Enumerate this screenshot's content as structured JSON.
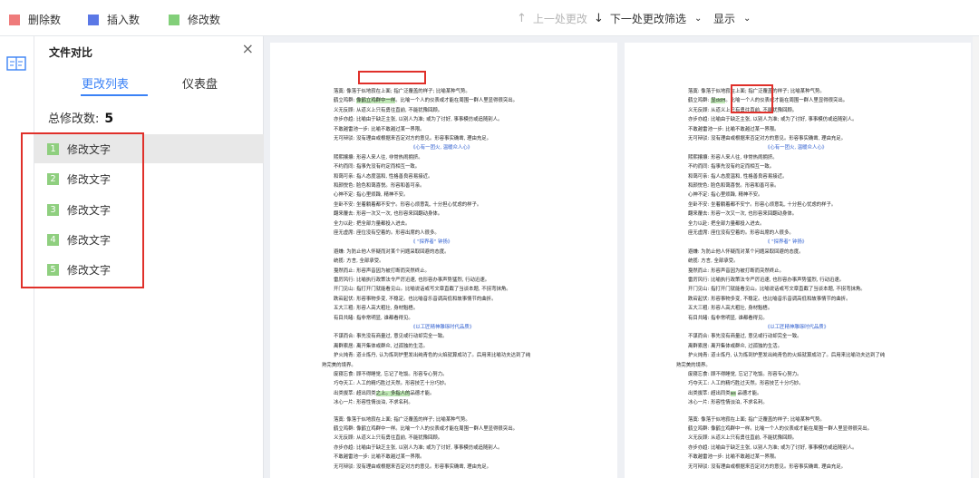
{
  "legend": [
    {
      "label": "删除数",
      "color": "#ef7b7b"
    },
    {
      "label": "插入数",
      "color": "#5b78e6"
    },
    {
      "label": "修改数",
      "color": "#82cf79"
    }
  ],
  "toolbar": {
    "prev_label": "上一处更改",
    "next_label": "下一处更改",
    "filter_label": "筛选",
    "display_label": "显示"
  },
  "panel": {
    "title": "文件对比",
    "tabs": [
      "更改列表",
      "仪表盘"
    ],
    "total_label": "总修改数:",
    "total_value": "5",
    "items": [
      {
        "num": "1",
        "label": "修改文字"
      },
      {
        "num": "2",
        "label": "修改文字"
      },
      {
        "num": "3",
        "label": "修改文字"
      },
      {
        "num": "4",
        "label": "修改文字"
      },
      {
        "num": "5",
        "label": "修改文字"
      }
    ]
  },
  "left_doc": [
    "落寞: 像落于似地寂在上面; 指广泛覆盖的样子; 比喻某种气势。",
    "鹤立鸡群: 像鹤立鸡群中一样。比喻一个人的仪表或才能在周围一群人里显得很突出。",
    "义无反顾: 从道义上只有勇往直前, 不能犹豫回顾。",
    "亦步亦趋: 比喻由于缺乏主张, 以别人为准; 或为了讨好, 事事模仿或追随别人。",
    "不敢越雷池一步: 比喻不敢越过某一界限。",
    "无可辩驳: 没有理由或根据来否定对方的意见。形容事实确凿, 理由充足。",
    "《心有一团火, 温暖众人心》",
    "熙熙攘攘: 形容人来人往, 非常热闹拥挤。",
    "不约而同: 指事先没有约定而相互一致。",
    "和蔼可亲: 指人态度温和, 性格善良容易接近。",
    "和颜悦色: 脸色和蔼喜悦。形容和善可亲。",
    "心神不定: 指心里烦躁, 精神不安。",
    "坐卧不安: 坐着躺着都不安宁。形容心烦意乱, 十分担心忧虑的样子。",
    "翻来覆去: 形容一次又一次, 也形容来回翻动身体。",
    "全力以赴: 把全部力量都投入进去。",
    "座无虚席: 座位没有空着的。形容出席的人很多。",
    "《 \"探界者\" 钟扬》",
    "避嫌: 为防止他人怀疑而对某个问题采取回避的态度。",
    "统揽: 方言, 全部承受。",
    "戛然而止: 形容声音因为被打断而突然终止。",
    "雷厉风行: 比喻执行政策法令严厉迅速, 也形容办事声势猛烈, 行动迅速。",
    "开门见山: 指打开门就能看见山。比喻说话或写文章直截了当谈本题, 不拐弯抹角。",
    "跌宕起伏: 形容事物多变, 不稳定。也比喻音乐音调高低和故事情节的曲折。",
    "五大三粗: 形容人高大粗壮, 身材魁梧。",
    "有目共睹: 指非常明显, 谁都看得见。",
    "《以工匠精神雕琢时代品质》",
    "不谋而合: 事先没有商量过, 意见或行动却完全一致。",
    "离群索居: 离开集体或群众, 过孤独的生活。",
    "护火炖青: 道士炼丹, 认为炼到炉里发出纯青色的火焰就算成功了。后用来比喻功夫达到了纯",
    "熟完美的境界。",
    "废寝忘食: 顾不得睡觉, 忘记了吃饭。形容专心努力。",
    "巧夺天工: 人工的精巧胜过天然。形容技艺十分巧妙。",
    "出类拔萃: 超出同类之上。多指人的品德才能。",
    "冰心一片: 形容性情淡泊, 不求名利。",
    "",
    "落寞: 像落于似地寂在上面; 指广泛覆盖的样子; 比喻某种气势。",
    "鹤立鸡群: 像鹤立鸡群中一样。比喻一个人的仪表或才能在周围一群人里显得很突出。",
    "义无反顾: 从道义上只有勇往直前, 不能犹豫回顾。",
    "亦步亦趋: 比喻由于缺乏主张, 以别人为准; 或为了讨好, 事事模仿或追随别人。",
    "不敢越雷池一步: 比喻不敢越过某一界限。",
    "无可辩驳: 没有理由或根据来否定对方的意见。形容事实确凿, 理由充足。"
  ],
  "right_doc": [
    "落寞: 像落于似地寂在上面; 指广泛覆盖的样子; 比喻某种气势。",
    "鹤立鸡群: 显ddH。比喻一个人的仪表或才能在周围一群人里显得很突出。",
    "义无反顾: 从道义上只有勇往直前, 不能犹豫回顾。",
    "亦步亦趋: 比喻由于缺乏主张, 以别人为准; 或为了讨好, 事事模仿或追随别人。",
    "不敢越雷池一步: 比喻不敢越过某一界限。",
    "无可辩驳: 没有理由或根据来否定对方的意见。形容事实确凿, 理由充足。",
    "《心有一团火, 温暖众人心》",
    "熙熙攘攘: 形容人来人往, 非常热闹拥挤。",
    "不约而同: 指事先没有约定而相互一致。",
    "和蔼可亲: 指人态度温和, 性格善良容易接近。",
    "和颜悦色: 脸色和蔼喜悦。形容和善可亲。",
    "心神不定: 指心里烦躁, 精神不安。",
    "坐卧不安: 坐着躺着都不安宁。形容心烦意乱, 十分担心忧虑的样子。",
    "翻来覆去: 形容一次又一次, 也形容来回翻动身体。",
    "全力以赴: 把全部力量都投入进去。",
    "座无虚席: 座位没有空着的。形容出席的人很多。",
    "《 \"探界者\" 钟扬》",
    "避嫌: 为防止他人怀疑而对某个问题采取回避的态度。",
    "统揽: 方言, 全部承受。",
    "戛然而止: 形容声音因为被打断而突然终止。",
    "雷厉风行: 比喻执行政策法令严厉迅速, 也形容办事声势猛烈, 行动迅速。",
    "开门见山: 指打开门就能看见山。比喻说话或写文章直截了当谈本题, 不拐弯抹角。",
    "跌宕起伏: 形容事物多变, 不稳定。也比喻音乐音调高低和故事情节的曲折。",
    "五大三粗: 形容人高大粗壮, 身材魁梧。",
    "有目共睹: 指非常明显, 谁都看得见。",
    "《以工匠精神雕琢时代品质》",
    "不谋而合: 事先没有商量过, 意见或行动却完全一致。",
    "离群索居: 离开集体或群众, 过孤独的生活。",
    "护火炖青: 道士炼丹, 认为炼到炉里发出纯青色的火焰就算成功了。后用来比喻功夫达到了纯",
    "熟完美的境界。",
    "废寝忘食: 顾不得睡觉, 忘记了吃饭。形容专心努力。",
    "巧夺天工: 人工的精巧胜过天然。形容技艺十分巧妙。",
    "出类拔萃: 超出同类as 品德才能。",
    "冰心一片: 形容性情淡泊, 不求名利。",
    "",
    "落寞: 像落于似地寂在上面; 指广泛覆盖的样子; 比喻某种气势。",
    "鹤立鸡群: 像鹤立鸡群中一样。比喻一个人的仪表或才能在周围一群人里显得很突出。",
    "义无反顾: 从道义上只有勇往直前, 不能犹豫回顾。",
    "亦步亦趋: 比喻由于缺乏主张, 以别人为准; 或为了讨好, 事事模仿或追随别人。",
    "不敢越雷池一步: 比喻不敢越过某一界限。",
    "无可辩驳: 没有理由或根据来否定对方的意见。形容事实确凿, 理由充足。"
  ]
}
